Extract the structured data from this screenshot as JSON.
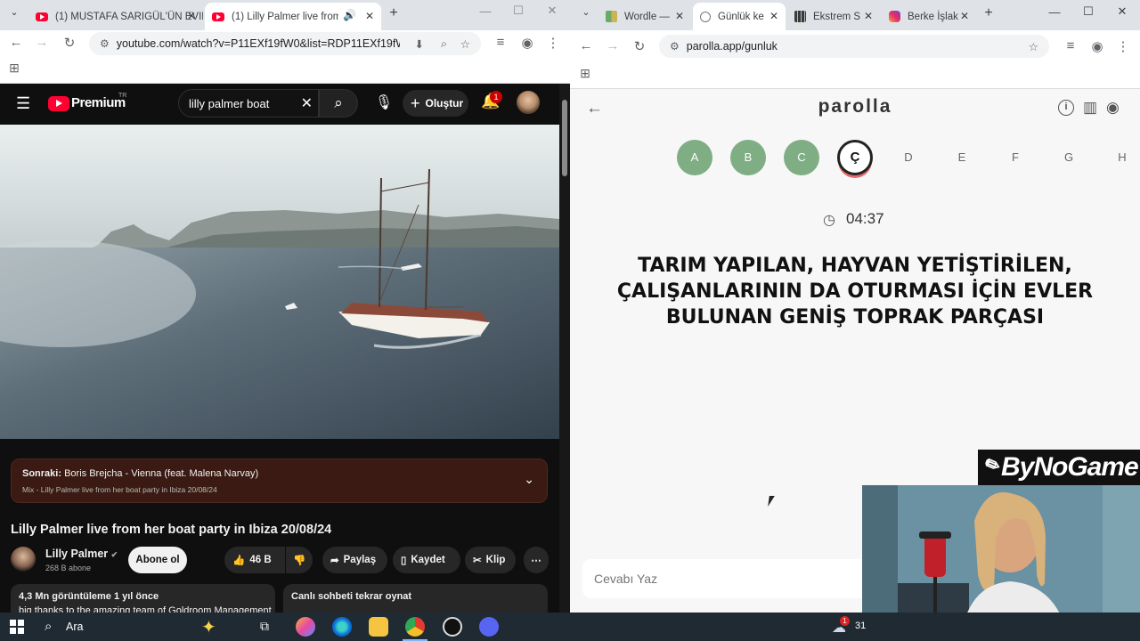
{
  "left_browser": {
    "tabs": [
      {
        "title": "(1) MUSTAFA SARIGÜL'ÜN EVIN",
        "active": false
      },
      {
        "title": "(1) Lilly Palmer live from her",
        "active": true
      }
    ],
    "url": "youtube.com/watch?v=P11EXf19fW0&list=RDP11EXf19fW0..."
  },
  "youtube": {
    "logo_text": "Premium",
    "logo_superscript": "TR",
    "search_value": "lilly palmer boat",
    "create_label": "Oluştur",
    "notification_count": "1",
    "next_up_label": "Sonraki:",
    "next_up_title": "Boris Brejcha - Vienna (feat. Malena Narvay)",
    "next_up_sub": "Mix - Lilly Palmer live from her boat party in Ibiza 20/08/24",
    "video_title": "Lilly Palmer live from her boat party in Ibiza 20/08/24",
    "channel_name": "Lilly Palmer",
    "subscribers": "268 B abone",
    "subscribe_label": "Abone ol",
    "likes": "46 B",
    "share_label": "Paylaş",
    "save_label": "Kaydet",
    "clip_label": "Klip",
    "views_line": "4,3 Mn görüntüleme  1 yıl önce",
    "desc_line": "big thanks to the amazing team of Goldroom Management",
    "chat_replay": "Canlı sohbeti tekrar oynat"
  },
  "right_browser": {
    "tabs": [
      {
        "title": "Wordle —",
        "active": false
      },
      {
        "title": "Günlük ke",
        "active": true
      },
      {
        "title": "Ekstrem S",
        "active": false
      },
      {
        "title": "Berke İşlak",
        "active": false
      }
    ],
    "url": "parolla.app/gunluk"
  },
  "parolla": {
    "logo": "parolla",
    "letters": [
      {
        "char": "A",
        "state": "done"
      },
      {
        "char": "B",
        "state": "done"
      },
      {
        "char": "C",
        "state": "done"
      },
      {
        "char": "Ç",
        "state": "current"
      },
      {
        "char": "D",
        "state": "pending"
      },
      {
        "char": "E",
        "state": "pending"
      },
      {
        "char": "F",
        "state": "pending"
      },
      {
        "char": "G",
        "state": "pending"
      },
      {
        "char": "H",
        "state": "pending"
      }
    ],
    "timer": "04:37",
    "question": "TARIM YAPILAN, HAYVAN YETİŞTİRİLEN, ÇALIŞANLARININ DA OTURMASI İÇİN EVLER BULUNAN GENİŞ TOPRAK PARÇASI",
    "answer_placeholder": "Cevabı Yaz",
    "colors": {
      "done": "#7fae84",
      "current_ring": "#222222",
      "current_underline": "#e46a6a"
    }
  },
  "overlay": {
    "brand": "ByNoGame"
  },
  "taskbar": {
    "search_label": "Ara",
    "weather_badge": "1",
    "clock_fragment": "31"
  }
}
